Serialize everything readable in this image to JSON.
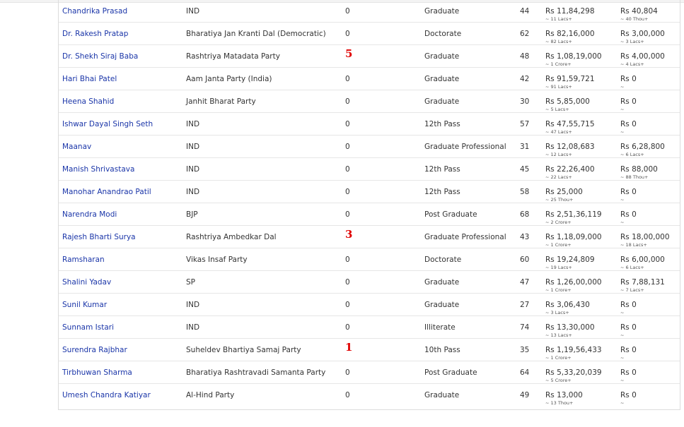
{
  "rows": [
    {
      "name": "Chandrika Prasad",
      "party": "IND",
      "cases": "0",
      "cases_highlight": false,
      "education": "Graduate",
      "age": "44",
      "assets": "Rs 11,84,298",
      "assets_sub": "~ 11 Lacs+",
      "liabilities": "Rs 40,804",
      "liabilities_sub": "~ 40 Thou+"
    },
    {
      "name": "Dr. Rakesh Pratap",
      "party": "Bharatiya Jan Kranti Dal (Democratic)",
      "cases": "0",
      "cases_highlight": false,
      "education": "Doctorate",
      "age": "62",
      "assets": "Rs 82,16,000",
      "assets_sub": "~ 82 Lacs+",
      "liabilities": "Rs 3,00,000",
      "liabilities_sub": "~ 3 Lacs+"
    },
    {
      "name": "Dr. Shekh Siraj Baba",
      "party": "Rashtriya Matadata Party",
      "cases": "5",
      "cases_highlight": true,
      "education": "Graduate",
      "age": "48",
      "assets": "Rs 1,08,19,000",
      "assets_sub": "~ 1 Crore+",
      "liabilities": "Rs 4,00,000",
      "liabilities_sub": "~ 4 Lacs+"
    },
    {
      "name": "Hari Bhai Patel",
      "party": "Aam Janta Party (India)",
      "cases": "0",
      "cases_highlight": false,
      "education": "Graduate",
      "age": "42",
      "assets": "Rs 91,59,721",
      "assets_sub": "~ 91 Lacs+",
      "liabilities": "Rs 0",
      "liabilities_sub": "~"
    },
    {
      "name": "Heena Shahid",
      "party": "Janhit Bharat Party",
      "cases": "0",
      "cases_highlight": false,
      "education": "Graduate",
      "age": "30",
      "assets": "Rs 5,85,000",
      "assets_sub": "~ 5 Lacs+",
      "liabilities": "Rs 0",
      "liabilities_sub": "~"
    },
    {
      "name": "Ishwar Dayal Singh Seth",
      "party": "IND",
      "cases": "0",
      "cases_highlight": false,
      "education": "12th Pass",
      "age": "57",
      "assets": "Rs 47,55,715",
      "assets_sub": "~ 47 Lacs+",
      "liabilities": "Rs 0",
      "liabilities_sub": "~"
    },
    {
      "name": "Maanav",
      "party": "IND",
      "cases": "0",
      "cases_highlight": false,
      "education": "Graduate Professional",
      "age": "31",
      "assets": "Rs 12,08,683",
      "assets_sub": "~ 12 Lacs+",
      "liabilities": "Rs 6,28,800",
      "liabilities_sub": "~ 6 Lacs+"
    },
    {
      "name": "Manish Shrivastava",
      "party": "IND",
      "cases": "0",
      "cases_highlight": false,
      "education": "12th Pass",
      "age": "45",
      "assets": "Rs 22,26,400",
      "assets_sub": "~ 22 Lacs+",
      "liabilities": "Rs 88,000",
      "liabilities_sub": "~ 88 Thou+"
    },
    {
      "name": "Manohar Anandrao Patil",
      "party": "IND",
      "cases": "0",
      "cases_highlight": false,
      "education": "12th Pass",
      "age": "58",
      "assets": "Rs 25,000",
      "assets_sub": "~ 25 Thou+",
      "liabilities": "Rs 0",
      "liabilities_sub": "~"
    },
    {
      "name": "Narendra Modi",
      "party": "BJP",
      "cases": "0",
      "cases_highlight": false,
      "education": "Post Graduate",
      "age": "68",
      "assets": "Rs 2,51,36,119",
      "assets_sub": "~ 2 Crore+",
      "liabilities": "Rs 0",
      "liabilities_sub": "~"
    },
    {
      "name": "Rajesh Bharti Surya",
      "party": "Rashtriya Ambedkar Dal",
      "cases": "3",
      "cases_highlight": true,
      "education": "Graduate Professional",
      "age": "43",
      "assets": "Rs 1,18,09,000",
      "assets_sub": "~ 1 Crore+",
      "liabilities": "Rs 18,00,000",
      "liabilities_sub": "~ 18 Lacs+"
    },
    {
      "name": "Ramsharan",
      "party": "Vikas Insaf Party",
      "cases": "0",
      "cases_highlight": false,
      "education": "Doctorate",
      "age": "60",
      "assets": "Rs 19,24,809",
      "assets_sub": "~ 19 Lacs+",
      "liabilities": "Rs 6,00,000",
      "liabilities_sub": "~ 6 Lacs+"
    },
    {
      "name": "Shalini Yadav",
      "party": "SP",
      "cases": "0",
      "cases_highlight": false,
      "education": "Graduate",
      "age": "47",
      "assets": "Rs 1,26,00,000",
      "assets_sub": "~ 1 Crore+",
      "liabilities": "Rs 7,88,131",
      "liabilities_sub": "~ 7 Lacs+"
    },
    {
      "name": "Sunil Kumar",
      "party": "IND",
      "cases": "0",
      "cases_highlight": false,
      "education": "Graduate",
      "age": "27",
      "assets": "Rs 3,06,430",
      "assets_sub": "~ 3 Lacs+",
      "liabilities": "Rs 0",
      "liabilities_sub": "~"
    },
    {
      "name": "Sunnam Istari",
      "party": "IND",
      "cases": "0",
      "cases_highlight": false,
      "education": "Illiterate",
      "age": "74",
      "assets": "Rs 13,30,000",
      "assets_sub": "~ 13 Lacs+",
      "liabilities": "Rs 0",
      "liabilities_sub": "~"
    },
    {
      "name": "Surendra Rajbhar",
      "party": "Suheldev Bhartiya Samaj Party",
      "cases": "1",
      "cases_highlight": true,
      "education": "10th Pass",
      "age": "35",
      "assets": "Rs 1,19,56,433",
      "assets_sub": "~ 1 Crore+",
      "liabilities": "Rs 0",
      "liabilities_sub": "~"
    },
    {
      "name": "Tirbhuwan Sharma",
      "party": "Bharatiya Rashtravadi Samanta Party",
      "cases": "0",
      "cases_highlight": false,
      "education": "Post Graduate",
      "age": "64",
      "assets": "Rs 5,33,20,039",
      "assets_sub": "~ 5 Crore+",
      "liabilities": "Rs 0",
      "liabilities_sub": "~"
    },
    {
      "name": "Umesh Chandra Katiyar",
      "party": "Al-Hind Party",
      "cases": "0",
      "cases_highlight": false,
      "education": "Graduate",
      "age": "49",
      "assets": "Rs 13,000",
      "assets_sub": "~ 13 Thou+",
      "liabilities": "Rs 0",
      "liabilities_sub": "~"
    }
  ]
}
